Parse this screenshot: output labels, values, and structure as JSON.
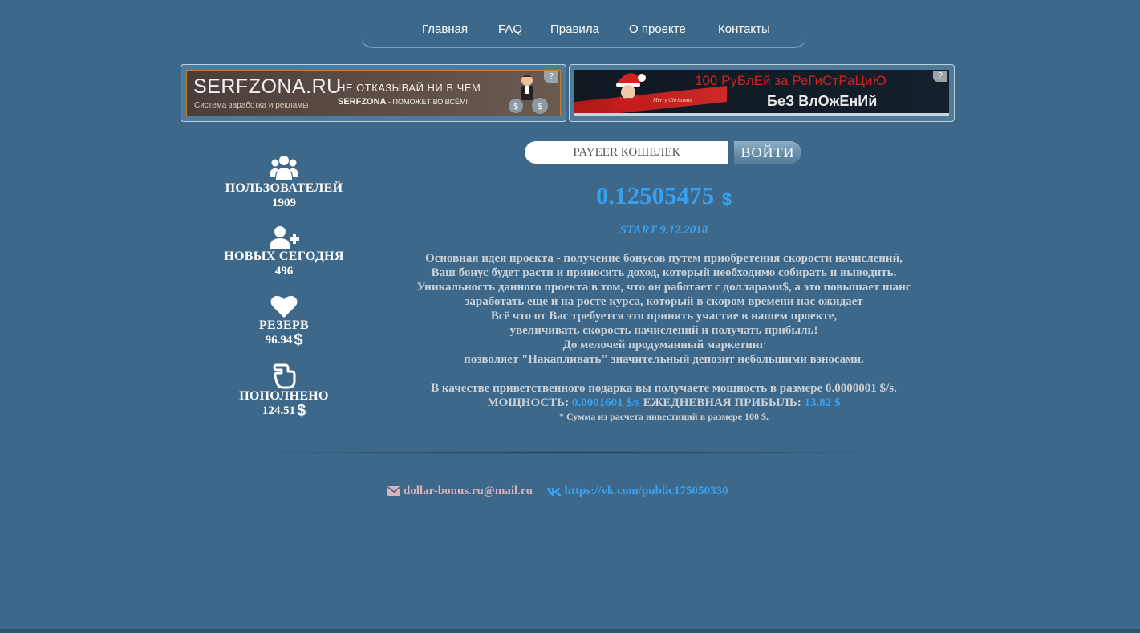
{
  "nav": {
    "items": [
      "Главная",
      "FAQ",
      "Правила",
      "О проекте",
      "Контакты"
    ]
  },
  "banners": {
    "left": {
      "brand": "SERFZONA.RU",
      "brand_sub": "Система заработка и рекламы",
      "slogan_line1": "НЕ ОТКАЗЫВАЙ НИ В ЧЁМ",
      "slogan_brand": "SERFZONA",
      "slogan_tail": " - ПОМОЖЕТ ВО ВСЁМ!",
      "badge": "?"
    },
    "right": {
      "promo_line1": "100 РуБлЕй за РеГиСтРаЦиЮ",
      "promo_line2": "БеЗ ВлОжЕнИй",
      "xmas": "Merry Christmas",
      "badge": "?"
    }
  },
  "stats": {
    "users": {
      "icon": "users-icon",
      "label": "ПОЛЬЗОВАТЕЛЕЙ",
      "value": "1909"
    },
    "new_today": {
      "icon": "user-plus-icon",
      "label": "НОВЫХ СЕГОДНЯ",
      "value": "496"
    },
    "reserve": {
      "icon": "heart-icon",
      "label": "РЕЗЕРВ",
      "value": "96.94",
      "currency": "$"
    },
    "deposited": {
      "icon": "hand-pointing-icon",
      "label": "ПОПОЛНЕНО",
      "value": "124.51",
      "currency": "$"
    }
  },
  "login": {
    "placeholder": "PAYEER КОШЕЛЕК",
    "button": "ВОЙТИ"
  },
  "balance": {
    "value": "0.12505475",
    "currency": "$"
  },
  "start_text": "START 9.12.2018",
  "description": [
    "Основная идея проекта - получение бонусов путем приобретения скорости начислений,",
    "Ваш бонус будет расти и приносить доход, который необходимо собирать и выводить.",
    "Уникальность данного проекта в том, что он работает с долларами$, а это повышает шанс",
    "заработать еще и на росте курса, который в скором времени нас ожидает",
    "Всё что от Вас требуется это принять участие в нашем проекте,",
    "увеличивать скорость начислений и получать прибыль!",
    "До мелочей продуманный маркетинг",
    "позволяет \"Накапливать\" значительный депозит небольшими взносами."
  ],
  "gift_text": "В качестве приветственного подарка вы получаете мощность в размере 0.0000001 $/s.",
  "power": {
    "label": "МОЩНОСТЬ:",
    "value": "0.0001601 $/s",
    "daily_label": "ЕЖЕДНЕВНАЯ ПРИБЫЛЬ:",
    "daily_value": "13.82 $"
  },
  "note": "* Сумма из расчета инвестиций в размере 100 $.",
  "footer": {
    "email": "dollar-bonus.ru@mail.ru",
    "vk": "https://vk.com/public175050330"
  },
  "colors": {
    "background": "#3d6889",
    "accent_blue": "#37a0f0",
    "email_pink": "#d9b2bb",
    "text_light": "#c8d0d8"
  }
}
